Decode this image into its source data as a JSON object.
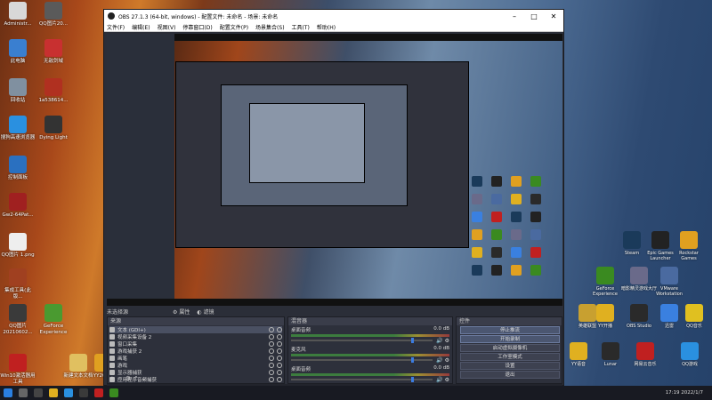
{
  "desktop": {
    "left_icons": [
      {
        "label": "Administr...",
        "color": "#d8d8d8"
      },
      {
        "label": "QQ图片20...",
        "color": "#5a5a5a"
      },
      {
        "label": "此电脑",
        "color": "#3a7fd0"
      },
      {
        "label": "无敌剑域",
        "color": "#c83030"
      },
      {
        "label": "回收站",
        "color": "#8090a0"
      },
      {
        "label": "1a538614...",
        "color": "#b03020"
      },
      {
        "label": "搜狗高速浏览器",
        "color": "#2a90e0"
      },
      {
        "label": "Dying Light",
        "color": "#333333"
      },
      {
        "label": "控制面板",
        "color": "#2a70c0"
      },
      {
        "label": "Gw2-64Pat...",
        "color": "#a02020"
      },
      {
        "label": "QQ图片 1.png",
        "color": "#eeeeee"
      },
      {
        "label": "集成工具(此版...",
        "color": "#a04020"
      },
      {
        "label": "QQ图片20210602...",
        "color": "#3a3a3a"
      },
      {
        "label": "GeForce Experience",
        "color": "#4a9a30"
      },
      {
        "label": "Win10激活器用工具",
        "color": "#c02020"
      },
      {
        "label": "新建文本文档",
        "color": "#e0c060"
      },
      {
        "label": "YY202...",
        "color": "#e0a020"
      }
    ],
    "right_icons": [
      {
        "label": "Steam",
        "color": "#1a3a5a"
      },
      {
        "label": "Epic Games Launcher",
        "color": "#222222"
      },
      {
        "label": "Rockstar Games",
        "color": "#e0a020"
      },
      {
        "label": "GeForce Experience",
        "color": "#3a8a20"
      },
      {
        "label": "暗影精灵游戏大厅",
        "color": "#6a6a8a"
      },
      {
        "label": "VMware Workstation",
        "color": "#4a6aa0"
      },
      {
        "label": "YY开播",
        "color": "#e0b020"
      },
      {
        "label": "OBS Studio",
        "color": "#2a2a2a"
      },
      {
        "label": "迅雷",
        "color": "#3a80e0"
      },
      {
        "label": "YY语音",
        "color": "#e0b020"
      },
      {
        "label": "Lunar",
        "color": "#2a2a2a"
      },
      {
        "label": "网易云音乐",
        "color": "#c02020"
      },
      {
        "label": "QQ游戏",
        "color": "#2a90e0"
      },
      {
        "label": "英雄联盟",
        "color": "#c8a030"
      },
      {
        "label": "QQ音乐",
        "color": "#e0c020"
      }
    ]
  },
  "obs": {
    "title": "OBS 27.1.3 (64-bit, windows) - 配置文件: 未命名 - 场景: 未命名",
    "menus": [
      "文件(F)",
      "编辑(E)",
      "视图(V)",
      "停靠窗口(D)",
      "配置文件(P)",
      "场景集合(S)",
      "工具(T)",
      "帮助(H)"
    ],
    "subbar": {
      "label": "未选择源",
      "props": "属性",
      "filters": "滤镜"
    },
    "scenes": {
      "header": "来源",
      "items": [
        "文本 (GDI+)",
        "视频采集设备 2",
        "窗口采集",
        "游戏捕获 2",
        "画笔",
        "游戏",
        "显示器捕获",
        "应用程序音频捕获",
        "媒体源",
        "回放",
        "图像"
      ]
    },
    "mixer": {
      "header": "混音器",
      "channels": [
        {
          "name": "桌面音频",
          "db": "0.0 dB",
          "level": 0.85
        },
        {
          "name": "麦克风",
          "db": "0.0 dB",
          "level": 0.85
        },
        {
          "name": "桌面音频",
          "db": "0.0 dB",
          "level": 0.85
        }
      ]
    },
    "controls": {
      "header": "控件",
      "buttons": [
        "停止推流",
        "开始录制",
        "启动虚拟摄像机",
        "工作室模式",
        "设置",
        "退出"
      ]
    }
  },
  "taskbar": {
    "time": "17:19",
    "date": "2022/1/7"
  }
}
